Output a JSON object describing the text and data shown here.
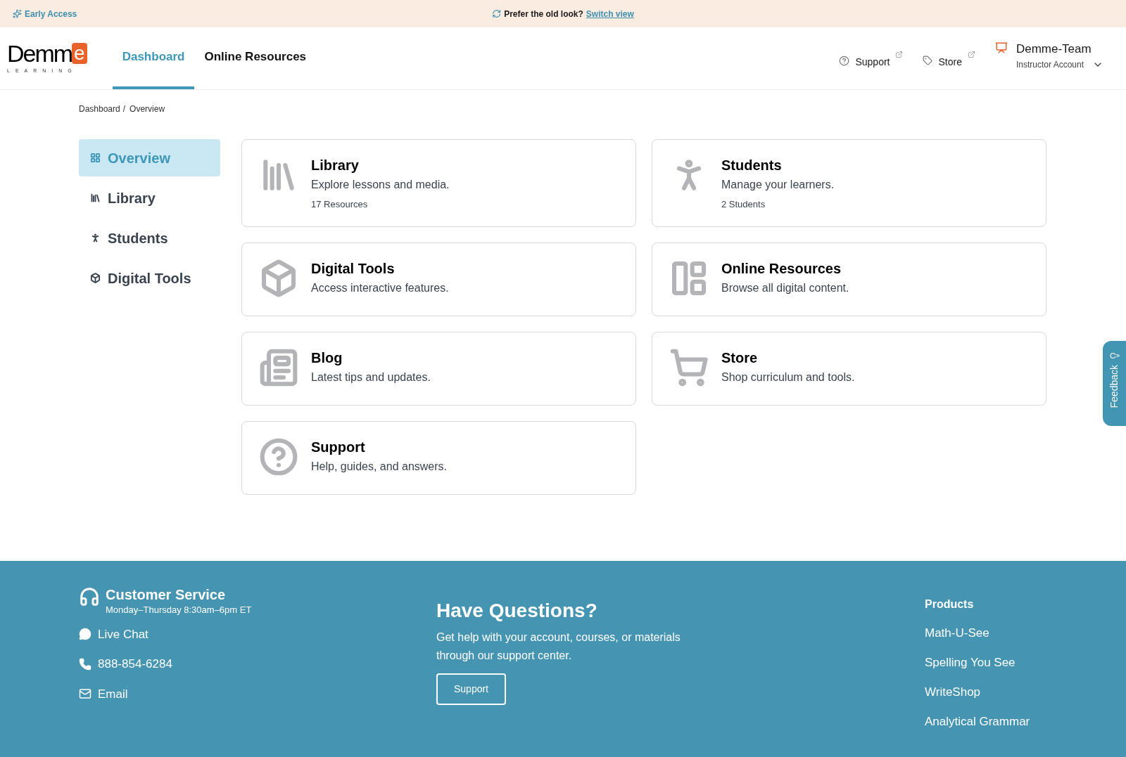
{
  "banner": {
    "badge": "Early Access",
    "prompt": "Prefer the old look?",
    "link": "Switch view"
  },
  "header": {
    "logo": {
      "wordmark": "Demm",
      "mark": "e",
      "tagline": "LEARNING"
    },
    "tabs": [
      {
        "label": "Dashboard",
        "selected": true
      },
      {
        "label": "Online Resources",
        "selected": false
      }
    ],
    "links": [
      "Support",
      "Store"
    ],
    "account": {
      "name": "Demme-Team",
      "role": "Instructor Account"
    }
  },
  "breadcrumb": {
    "items": [
      "Dashboard",
      "Overview"
    ],
    "separator": "/"
  },
  "sidebar": {
    "items": [
      {
        "label": "Overview",
        "selected": true
      },
      {
        "label": "Library",
        "selected": false
      },
      {
        "label": "Students",
        "selected": false
      },
      {
        "label": "Digital Tools",
        "selected": false
      }
    ]
  },
  "cards": [
    {
      "title": "Library",
      "description": "Explore lessons and media.",
      "count": "17 Resources"
    },
    {
      "title": "Students",
      "description": "Manage your learners.",
      "count": "2 Students"
    },
    {
      "title": "Digital Tools",
      "description": "Access interactive features."
    },
    {
      "title": "Online Resources",
      "description": "Browse all digital content."
    },
    {
      "title": "Blog",
      "description": "Latest tips and updates."
    },
    {
      "title": "Store",
      "description": "Shop curriculum and tools."
    },
    {
      "title": "Support",
      "description": "Help, guides, and answers."
    }
  ],
  "feedback_tab": "Feedback",
  "footer": {
    "service": {
      "title": "Customer Service",
      "hours": "Monday–Thursday 8:30am–6pm ET",
      "contacts": [
        "Live Chat",
        "888-854-6284",
        "Email"
      ]
    },
    "questions": {
      "title": "Have Questions?",
      "text": "Get help with your account, courses, or materials through our support center.",
      "button": "Support"
    },
    "products": {
      "title": "Products",
      "items": [
        "Math-U-See",
        "Spelling You See",
        "WriteShop",
        "Analytical Grammar"
      ]
    }
  }
}
